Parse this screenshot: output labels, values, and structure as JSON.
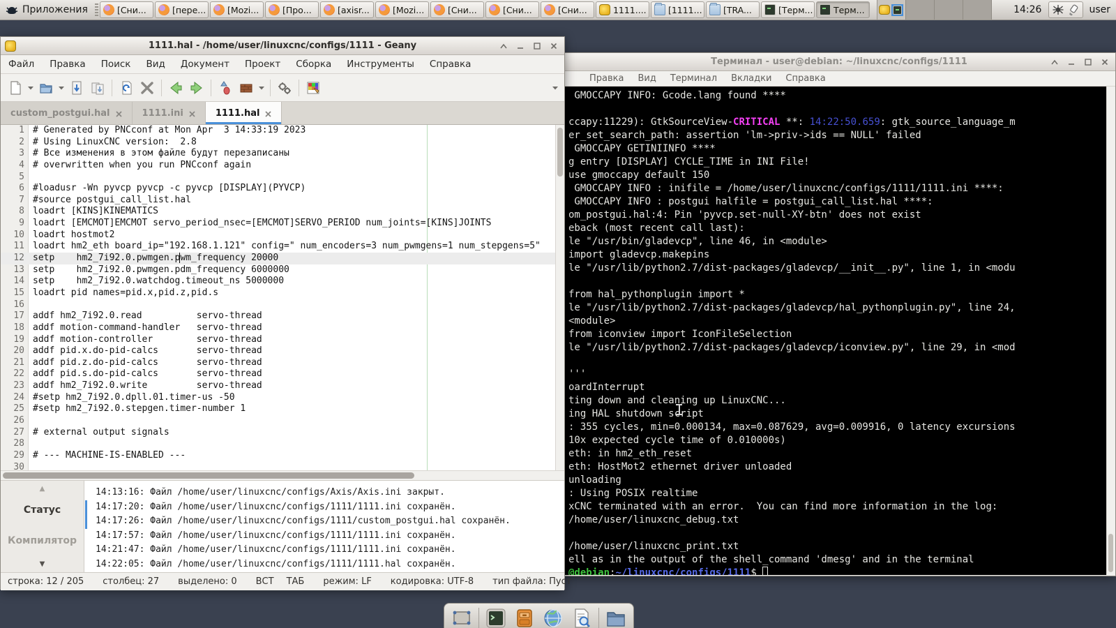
{
  "desktop": {
    "bg": "#3a4150"
  },
  "taskbar": {
    "menu_label": "Приложения",
    "clock": "14:26",
    "user_label": "user",
    "tray_icons": [
      "drweb-spider-icon",
      "usb-eject-icon"
    ],
    "workspace_count": 4,
    "buttons": [
      {
        "label": "[Сни...",
        "icon": "firefox",
        "active": false
      },
      {
        "label": "[пере...",
        "icon": "firefox",
        "active": false
      },
      {
        "label": "[Mozi...",
        "icon": "firefox",
        "active": false
      },
      {
        "label": "[Про...",
        "icon": "firefox",
        "active": false
      },
      {
        "label": "[axisr...",
        "icon": "firefox",
        "active": false
      },
      {
        "label": "[Mozi...",
        "icon": "firefox",
        "active": false
      },
      {
        "label": "[Сни...",
        "icon": "firefox",
        "active": false
      },
      {
        "label": "[Сни...",
        "icon": "firefox",
        "active": false
      },
      {
        "label": "[Сни...",
        "icon": "firefox",
        "active": false
      },
      {
        "label": "1111....",
        "icon": "geany",
        "active": false
      },
      {
        "label": "[1111...",
        "icon": "folder",
        "active": false
      },
      {
        "label": "[TRA...",
        "icon": "folder",
        "active": false
      },
      {
        "label": "[Терм...",
        "icon": "terminal",
        "active": false
      },
      {
        "label": "Терм...",
        "icon": "terminal",
        "active": true
      }
    ]
  },
  "geany": {
    "title": "1111.hal - /home/user/linuxcnc/configs/1111 - Geany",
    "menu": [
      "Файл",
      "Правка",
      "Поиск",
      "Вид",
      "Документ",
      "Проект",
      "Сборка",
      "Инструменты",
      "Справка"
    ],
    "toolbar": [
      "new-file",
      "dropdown",
      "open-file",
      "dropdown",
      "save-file",
      "save-all",
      "sep",
      "revert-file",
      "close-file",
      "sep",
      "nav-back",
      "nav-forward",
      "sep",
      "compile",
      "build",
      "dropdown",
      "sep",
      "run",
      "sep",
      "color-chooser"
    ],
    "tabs": [
      {
        "label": "custom_postgui.hal",
        "active": false
      },
      {
        "label": "1111.ini",
        "active": false
      },
      {
        "label": "1111.hal",
        "active": true
      }
    ],
    "editor": {
      "caret_line": 12,
      "caret_col": 27,
      "lines": [
        "# Generated by PNCconf at Mon Apr  3 14:33:19 2023",
        "# Using LinuxCNC version:  2.8",
        "# Все изменения в этом файле будут перезаписаны",
        "# overwritten when you run PNCconf again",
        "",
        "#loadusr -Wn pyvcp pyvcp -c pyvcp [DISPLAY](PYVCP)",
        "#source postgui_call_list.hal",
        "loadrt [KINS]KINEMATICS",
        "loadrt [EMCMOT]EMCMOT servo_period_nsec=[EMCMOT]SERVO_PERIOD num_joints=[KINS]JOINTS",
        "loadrt hostmot2",
        "loadrt hm2_eth board_ip=\"192.168.1.121\" config=\" num_encoders=3 num_pwmgens=1 num_stepgens=5\"",
        "setp    hm2_7i92.0.pwmgen.pwm_frequency 20000",
        "setp    hm2_7i92.0.pwmgen.pdm_frequency 6000000",
        "setp    hm2_7i92.0.watchdog.timeout_ns 5000000",
        "loadrt pid names=pid.x,pid.z,pid.s",
        "",
        "addf hm2_7i92.0.read          servo-thread",
        "addf motion-command-handler   servo-thread",
        "addf motion-controller        servo-thread",
        "addf pid.x.do-pid-calcs       servo-thread",
        "addf pid.z.do-pid-calcs       servo-thread",
        "addf pid.s.do-pid-calcs       servo-thread",
        "addf hm2_7i92.0.write         servo-thread",
        "#setp hm2_7i92.0.dpll.01.timer-us -50",
        "#setp hm2_7i92.0.stepgen.timer-number 1",
        "",
        "# external output signals",
        "",
        "# --- MACHINE-IS-ENABLED ---",
        ""
      ]
    },
    "sidebar_tabs": [
      "Статус",
      "Компилятор"
    ],
    "status_messages": [
      "14:13:16: Файл /home/user/linuxcnc/configs/Axis/Axis.ini закрыт.",
      "14:17:20: Файл /home/user/linuxcnc/configs/1111/1111.ini сохранён.",
      "14:17:26: Файл /home/user/linuxcnc/configs/1111/custom_postgui.hal сохранён.",
      "14:17:57: Файл /home/user/linuxcnc/configs/1111/1111.ini сохранён.",
      "14:21:47: Файл /home/user/linuxcnc/configs/1111/1111.ini сохранён.",
      "14:22:05: Файл /home/user/linuxcnc/configs/1111/1111.hal сохранён."
    ],
    "marker_rows": [
      1,
      2
    ],
    "statusbar": {
      "line": "строка: 12 / 205",
      "column": "столбец: 27",
      "selection": "выделено: 0",
      "insert_mode": "ВСТ",
      "tab_mode": "ТАБ",
      "eol_mode": "режим: LF",
      "encoding": "кодировка: UTF-8",
      "filetype": "тип файла: Пуст"
    }
  },
  "terminal": {
    "title": "Терминал - user@debian: ~/linuxcnc/configs/1111",
    "menu": [
      "Правка",
      "Вид",
      "Терминал",
      "Вкладки",
      "Справка"
    ],
    "colors": {
      "magenta": "#f540f5",
      "timestamp_blue": "#4650d2",
      "prompt_green": "#3ec43e",
      "prompt_blue": "#5468e8"
    },
    "lines": [
      " GMOCCAPY INFO: Gcode.lang found ****",
      "",
      [
        {
          "t": "ccapy:11229): GtkSourceView-"
        },
        {
          "t": "CRITICAL",
          "c": "magenta",
          "b": true
        },
        {
          "t": " **: "
        },
        {
          "t": "14:22:50.659",
          "c": "timestamp_blue"
        },
        {
          "t": ": gtk_source_language_m"
        }
      ],
      "er_set_search_path: assertion 'lm->priv->ids == NULL' failed",
      " GMOCCAPY GETINIINFO ****",
      "g entry [DISPLAY] CYCLE_TIME in INI File!",
      "use gmoccapy default 150",
      " GMOCCAPY INFO : inifile = /home/user/linuxcnc/configs/1111/1111.ini ****:",
      " GMOCCAPY INFO : postgui halfile = postgui_call_list.hal ****:",
      "om_postgui.hal:4: Pin 'pyvcp.set-null-XY-btn' does not exist",
      "eback (most recent call last):",
      "le \"/usr/bin/gladevcp\", line 46, in <module>",
      "import gladevcp.makepins",
      "le \"/usr/lib/python2.7/dist-packages/gladevcp/__init__.py\", line 1, in <modu",
      "",
      "from hal_pythonplugin import *",
      "le \"/usr/lib/python2.7/dist-packages/gladevcp/hal_pythonplugin.py\", line 24,",
      "<module>",
      "from iconview import IconFileSelection",
      "le \"/usr/lib/python2.7/dist-packages/gladevcp/iconview.py\", line 29, in <mod",
      "",
      "'''",
      "oardInterrupt",
      "ting down and cleaning up LinuxCNC...",
      "ing HAL shutdown script",
      ": 355 cycles, min=0.000134, max=0.087629, avg=0.009916, 0 latency excursions",
      "10x expected cycle time of 0.010000s)",
      "eth: in hm2_eth_reset",
      "eth: HostMot2 ethernet driver unloaded",
      "unloading",
      ": Using POSIX realtime",
      "xCNC terminated with an error.  You can find more information in the log:",
      "/home/user/linuxcnc_debug.txt",
      "",
      "/home/user/linuxcnc_print.txt",
      "ell as in the output of the shell_command 'dmesg' and in the terminal",
      [
        {
          "t": "@debian",
          "c": "prompt_green",
          "b": true
        },
        {
          "t": ":"
        },
        {
          "t": "~/linuxcnc/configs/1111",
          "c": "prompt_blue",
          "b": true
        },
        {
          "t": "$ "
        },
        {
          "cursor": true
        }
      ]
    ]
  },
  "dock": {
    "icons": [
      "show-desktop",
      "terminal",
      "file-manager",
      "web-browser",
      "search",
      "file-folder"
    ]
  },
  "window_controls": [
    "shade",
    "minimize",
    "maximize",
    "close"
  ]
}
